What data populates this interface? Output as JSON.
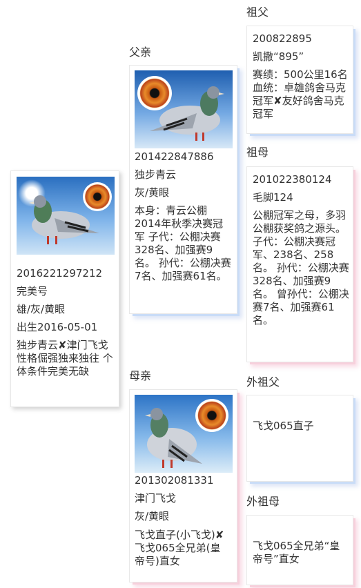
{
  "labels": {
    "grandfather": "祖父",
    "father": "父亲",
    "grandmother": "祖母",
    "mother": "母亲",
    "maternal_grandfather": "外祖父",
    "maternal_grandmother": "外祖母"
  },
  "subject": {
    "ring": "2016221297212",
    "name": "完美号",
    "attrs": "雄/灰/黄眼",
    "born": "出生2016-05-01",
    "notes": "独步青云✘津门飞戈 性格倔强独来独往 个体条件完美无缺"
  },
  "father": {
    "ring": "201422847886",
    "name": "独步青云",
    "attrs": "灰/黄眼",
    "notes": "本身：青云公棚2014年秋季决赛冠军 子代：公棚决赛328名、加强赛9名。 孙代：公棚决赛7名、加强赛61名。"
  },
  "mother": {
    "ring": "201302081331",
    "name": "津门飞戈",
    "attrs": "灰/黄眼",
    "notes": "飞戈直子(小飞戈)✘飞戈065全兄弟(皇帝号)直女"
  },
  "grandfather": {
    "ring": "200822895",
    "name": "凯撒“895”",
    "notes": "赛绩：500公里16名 血统：卓雄鸽舍马克冠军✘友好鸽舍马克冠军"
  },
  "grandmother": {
    "ring": "201022380124",
    "name": "毛脚124",
    "notes": "公棚冠军之母，多羽公棚获奖鸽之源头。 子代：公棚决赛冠军、238名、258名。 孙代：公棚决赛328名、加强赛9名。 曾孙代：公棚决赛7名、加强赛61名。"
  },
  "maternal_grandfather": {
    "notes": "飞戈065直子"
  },
  "maternal_grandmother": {
    "notes": "飞戈065全兄弟“皇帝号”直女"
  }
}
